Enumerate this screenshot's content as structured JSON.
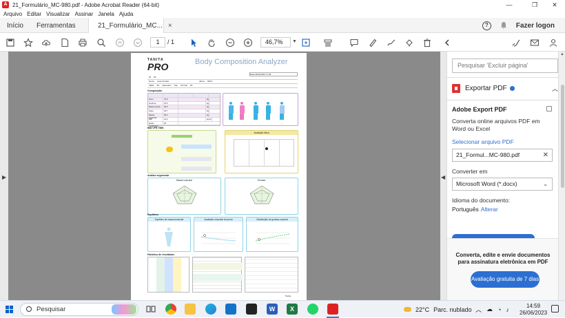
{
  "window": {
    "title": "21_Formulário_MC-980.pdf - Adobe Acrobat Reader (64-bit)",
    "controls": {
      "minimize": "—",
      "maximize": "❐",
      "close": "✕"
    }
  },
  "menu": [
    "Arquivo",
    "Editar",
    "Visualizar",
    "Assinar",
    "Janela",
    "Ajuda"
  ],
  "tabs": {
    "home": "Início",
    "tools": "Ferramentas",
    "document": "21_Formulário_MC...",
    "close": "×"
  },
  "header_right": {
    "help": "?",
    "login": "Fazer logon"
  },
  "toolbar": {
    "page_current": "1",
    "page_total": "/ 1",
    "zoom": "46,7%",
    "icons": [
      "save-icon",
      "star-icon",
      "upload-icon",
      "file-icon",
      "print-icon",
      "zoom-search-icon",
      "page-up-icon",
      "page-down-icon",
      "select-arrow-icon",
      "hand-icon",
      "zoom-out-icon",
      "zoom-in-icon",
      "fit-page-icon",
      "scroll-mode-icon",
      "comment-icon",
      "highlight-icon",
      "draw-icon",
      "stamp-icon",
      "delete-icon",
      "sign-icon",
      "mail-icon",
      "share-icon"
    ]
  },
  "document": {
    "brand_top": "TANITA",
    "brand_main": "PRO",
    "title": "Body Composition Analyzer",
    "date_label": "Data",
    "date_value": "06/11/2023 17:09",
    "id_rows": [
      [
        "ID",
        "00"
      ],
      [
        "Nome",
        "Luan Amaral",
        "Altura",
        "180,0"
      ],
      [
        "Idade",
        "28",
        "masculino",
        "Tipo",
        "Normal",
        "PT"
      ]
    ],
    "sections": {
      "composition": "Composição",
      "bmi": "BMI VFR TBW",
      "segmental": "Análise segmentar",
      "balance": "Equilíbrio",
      "history": "Histórico de resultados"
    },
    "panels": {
      "physique": "Avaliação física",
      "muscle": "Massa muscular",
      "fat": "Gordura",
      "balance1": "Equilíbrio de massa muscular",
      "balance2": "Avaliação muscular de perna",
      "balance3": "Distribuição de gordura corporal"
    },
    "composition_rows": [
      [
        "Peso",
        "79,0",
        "kg"
      ],
      [
        "Gordura",
        "15,5",
        "kg"
      ],
      [
        "Massa isenta",
        "63,5",
        "kg"
      ],
      [
        "Água",
        "46,7",
        "kg"
      ],
      [
        "Massa muscular",
        "60,3",
        "kg"
      ],
      [
        "BMI",
        "24,4",
        "kg/m²"
      ],
      [
        "Idade metabólica",
        "18",
        ""
      ]
    ],
    "balance_values": [
      "1,2",
      "12,3",
      "2,5"
    ],
    "footer": "Tanita"
  },
  "right_panel": {
    "search_placeholder": "Pesquisar 'Excluir página'",
    "export_label": "Exportar PDF",
    "export_title": "Adobe Export PDF",
    "description": "Converta online arquivos PDF em Word ou Excel",
    "select_file": "Selecionar arquivo PDF",
    "file_name": "21_Formul...MC-980.pdf",
    "convert_to_label": "Converter em",
    "convert_to_value": "Microsoft Word (*.docx)",
    "language_label": "Idioma do documento:",
    "language_value": "Português",
    "language_change": "Alterar",
    "promo_text": "Converta, edite e envie documentos para assinatura eletrônica em PDF",
    "promo_button": "Avaliação gratuita de 7 dias"
  },
  "taskbar": {
    "search": "Pesquisar",
    "weather_temp": "22°C",
    "weather_text": "Parc. nublado",
    "time": "14:59",
    "date": "26/06/2023",
    "colors": {
      "chrome": "#e8a33a",
      "edge": "#2b7de1",
      "word": "#2b5eb8",
      "excel": "#1f7a45",
      "whatsapp": "#25d366",
      "acrobat": "#d22"
    }
  }
}
